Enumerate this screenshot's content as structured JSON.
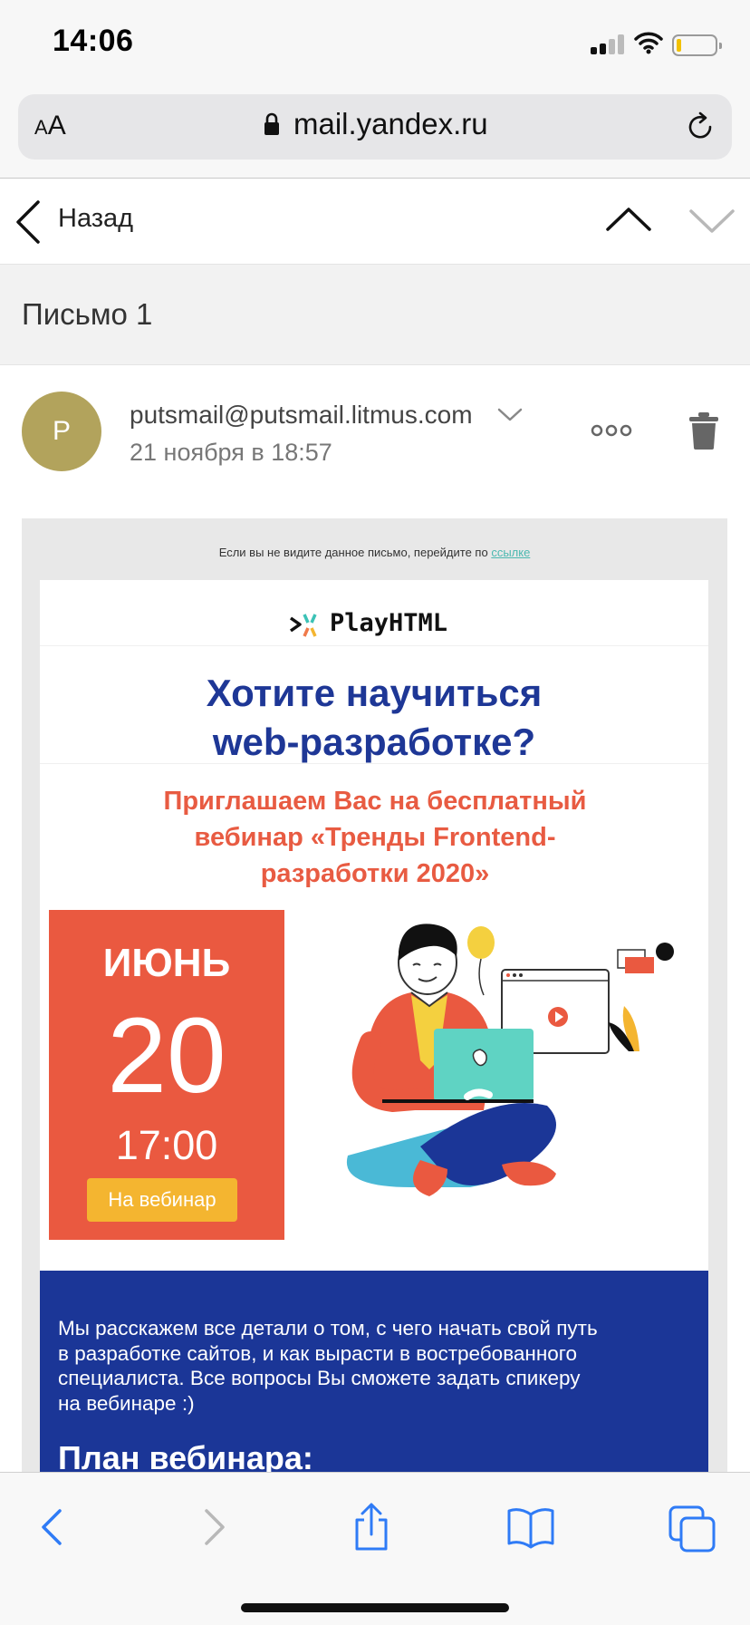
{
  "status_bar": {
    "time": "14:06"
  },
  "browser": {
    "text_size_label_small": "A",
    "text_size_label_large": "A",
    "url": "mail.yandex.ru"
  },
  "nav": {
    "back_label": "Назад"
  },
  "message": {
    "subject": "Письмо 1",
    "sender_initial": "P",
    "sender_email": "putsmail@putsmail.litmus.com",
    "date": "21 ноября в 18:57"
  },
  "email": {
    "preheader_text": "Если вы не видите данное письмо, перейдите по ",
    "preheader_link": "ссылке",
    "logo_text": "PlayHTML",
    "headline_line1": "Хотите научиться",
    "headline_line2": "web-разработке?",
    "subheadline": "Приглашаем Вас на бесплатный вебинар «Тренды Frontend-разработки 2020»",
    "event": {
      "month": "ИЮНЬ",
      "day": "20",
      "time": "17:00",
      "cta_label": "На вебинар"
    },
    "body_text": "Мы расскажем все детали о том, с чего начать свой путь в разработке сайтов, и как вырасти в востребованного специалиста. Все вопросы Вы сможете задать спикеру на вебинаре :)",
    "plan_heading": "План вебинара:"
  },
  "colors": {
    "brand_blue": "#1e3796",
    "accent_red": "#ea5940",
    "cta_yellow": "#f4b530",
    "avatar_olive": "#b2a35c",
    "ios_blue": "#2f7bf6"
  }
}
